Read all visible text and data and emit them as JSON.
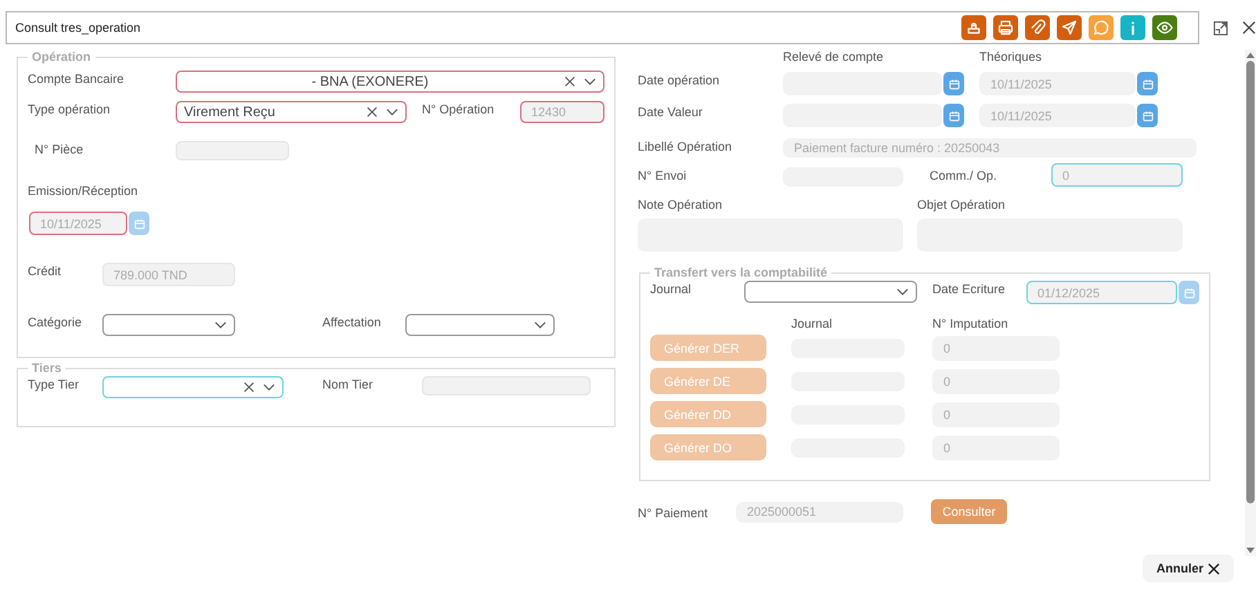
{
  "window": {
    "title": "Consult tres_operation"
  },
  "toolbar": [
    {
      "kind": "stamp",
      "color": "#d35f0e"
    },
    {
      "kind": "print",
      "color": "#d35f0e"
    },
    {
      "kind": "clip",
      "color": "#d35f0e"
    },
    {
      "kind": "send",
      "color": "#d35f0e"
    },
    {
      "kind": "chat",
      "color": "#f7a23c"
    },
    {
      "kind": "info",
      "color": "#17b4c6"
    },
    {
      "kind": "eye",
      "color": "#4b7d12"
    }
  ],
  "operation": {
    "legend": "Opération",
    "compte_bancaire": {
      "label": "Compte Bancaire",
      "value": "- BNA (EXONERE)",
      "invalid": true,
      "clearable": true
    },
    "type_operation": {
      "label": "Type opération",
      "value": "Virement Reçu",
      "invalid": true,
      "clearable": true
    },
    "numero_operation": {
      "label": "N° Opération",
      "value": "12430",
      "invalid": true
    },
    "numero_piece": {
      "label": "N° Pièce"
    },
    "emission_reception": {
      "label": "Emission/Réception",
      "value": "10/11/2025",
      "invalid": true,
      "disabled": true
    },
    "credit": {
      "label": "Crédit",
      "value": "789.000 TND"
    },
    "categorie": {
      "label": "Catégorie"
    },
    "affectation": {
      "label": "Affectation"
    }
  },
  "tiers": {
    "legend": "Tiers",
    "type_tier": {
      "label": "Type Tier",
      "focused": true,
      "clearable": true
    },
    "nom_tier": {
      "label": "Nom Tier"
    }
  },
  "dates": {
    "headers": [
      "Relevé de compte",
      "Théoriques"
    ],
    "rows": [
      {
        "label": "Date opération",
        "releve": {
          "disabled": false
        },
        "theorique": {
          "value": "10/11/2025",
          "disabled": false
        }
      },
      {
        "label": "Date Valeur",
        "releve": {
          "disabled": false
        },
        "theorique": {
          "value": "10/11/2025",
          "disabled": false
        }
      }
    ]
  },
  "libelle_operation": {
    "label": "Libellé Opération",
    "value": "Paiement facture numéro : 20250043"
  },
  "numero_envoi": {
    "label": "N° Envoi"
  },
  "commission": {
    "label": "Comm./ Op.",
    "value": "0",
    "focused": true
  },
  "note_operation": {
    "label": "Note Opération"
  },
  "objet_operation": {
    "label": "Objet Opération"
  },
  "transfert": {
    "legend": "Transfert vers la comptabilité",
    "journal": {
      "label": "Journal"
    },
    "date_ecriture": {
      "label": "Date Ecriture",
      "value": "01/12/2025",
      "focused": true,
      "disabled": true
    },
    "headers": [
      "Journal",
      "N° Imputation"
    ],
    "rows": [
      {
        "button": "Générer DER",
        "disabled": true,
        "imputation": "0"
      },
      {
        "button": "Générer DE",
        "disabled": true,
        "imputation": "0"
      },
      {
        "button": "Générer DD",
        "disabled": true,
        "imputation": "0"
      },
      {
        "button": "Générer DO",
        "disabled": true,
        "imputation": "0"
      }
    ]
  },
  "paiement": {
    "label": "N° Paiement",
    "value": "2025000051",
    "button": "Consulter"
  },
  "footer": {
    "cancel": "Annuler"
  }
}
